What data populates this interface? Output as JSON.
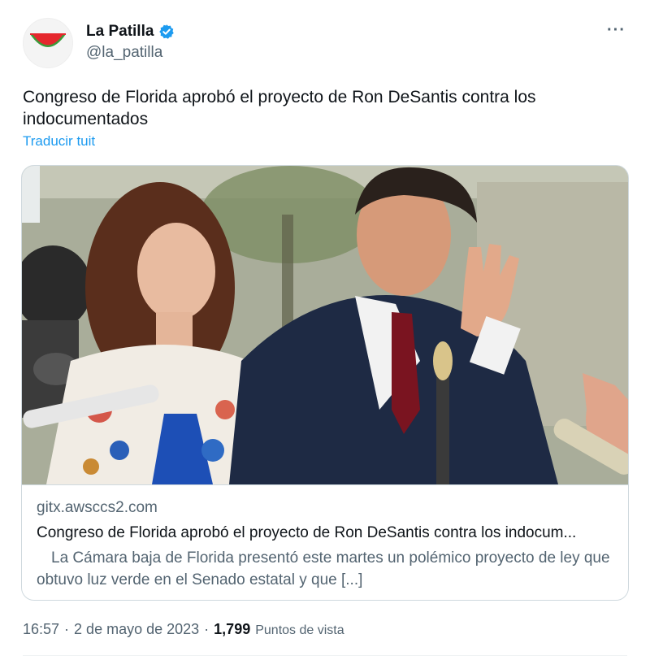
{
  "author": {
    "display_name": "La Patilla",
    "handle": "@la_patilla",
    "verified": true,
    "avatar_icon": "watermelon-logo-icon",
    "badge_icon": "verified-badge-icon"
  },
  "menu": {
    "more_label": "···",
    "icon": "more-options-icon"
  },
  "tweet": {
    "text": "Congreso de Florida aprobó el proyecto de Ron DeSantis contra los indocumentados",
    "translate_label": "Traducir tuit"
  },
  "card": {
    "image_icon": "news-photo",
    "domain": "gitx.awsccs2.com",
    "title": "Congreso de Florida aprobó el proyecto de Ron DeSantis contra los indocum...",
    "description": "La Cámara baja de Florida presentó este martes un polémico proyecto de ley que obtuvo luz verde en el Senado estatal y que [...]"
  },
  "meta": {
    "time": "16:57",
    "separator1": "·",
    "date": "2 de mayo de 2023",
    "separator2": "·",
    "views_count": "1,799",
    "views_label": "Puntos de vista"
  },
  "colors": {
    "link": "#1d9bf0",
    "secondary_text": "#536471",
    "primary_text": "#0f1419",
    "border": "#cfd9de",
    "brand_red": "#e5272d",
    "brand_green": "#3a9b3a"
  }
}
